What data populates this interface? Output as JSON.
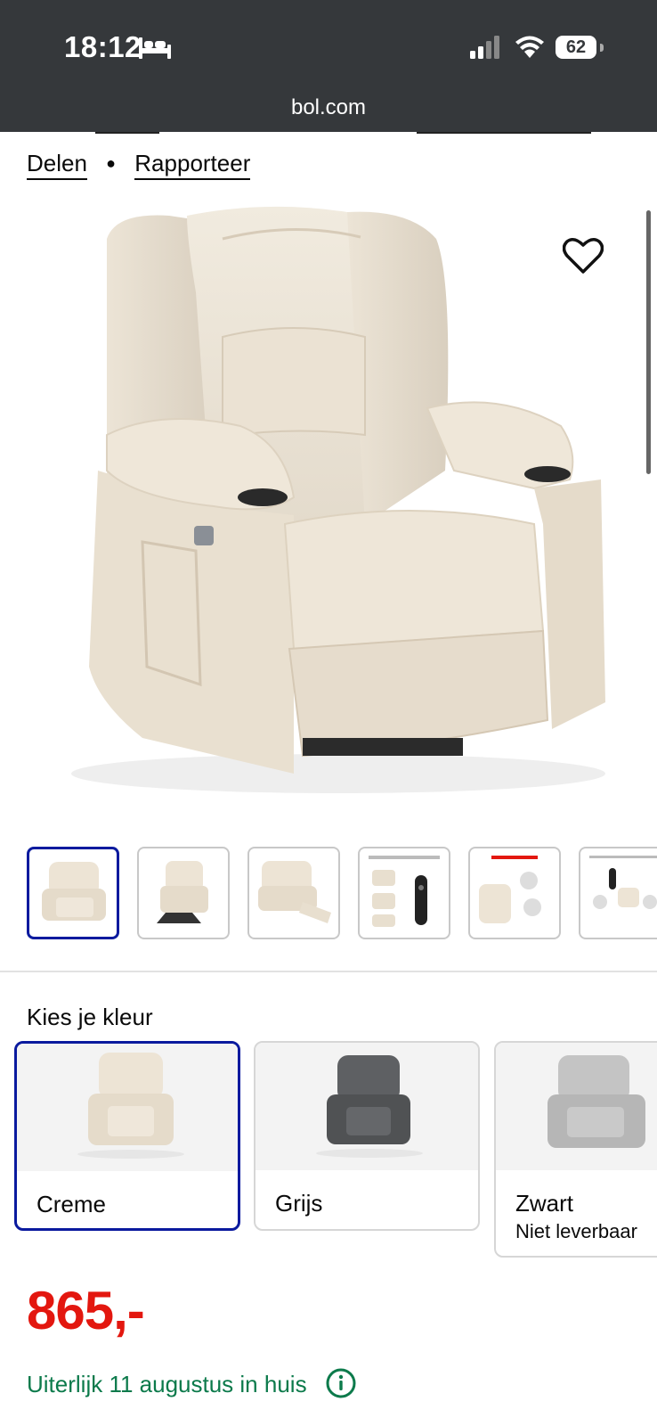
{
  "status_bar": {
    "time": "18:12",
    "battery": "62",
    "url": "bol.com"
  },
  "links": {
    "share": "Delen",
    "report": "Rapporteer"
  },
  "product_image": {
    "alt": "Creme fauteuil",
    "favorite_icon": "heart-icon"
  },
  "thumbnails": [
    {
      "name": "thumb-1",
      "selected": true
    },
    {
      "name": "thumb-2",
      "selected": false
    },
    {
      "name": "thumb-3",
      "selected": false
    },
    {
      "name": "thumb-4",
      "selected": false
    },
    {
      "name": "thumb-5",
      "selected": false
    },
    {
      "name": "thumb-6",
      "selected": false
    }
  ],
  "color_picker": {
    "title": "Kies je kleur",
    "options": [
      {
        "name": "Creme",
        "sub": "",
        "selected": true
      },
      {
        "name": "Grijs",
        "sub": "",
        "selected": false
      },
      {
        "name": "Zwart",
        "sub": "Niet leverbaar",
        "selected": false
      }
    ]
  },
  "price": "865,-",
  "delivery": {
    "text": "Uiterlijk 11 augustus in huis",
    "icon": "info-icon"
  },
  "colors": {
    "accent": "#0a1a9e",
    "price": "#e3170f",
    "delivery": "#0c7a4b",
    "statusbar": "#35383b"
  }
}
